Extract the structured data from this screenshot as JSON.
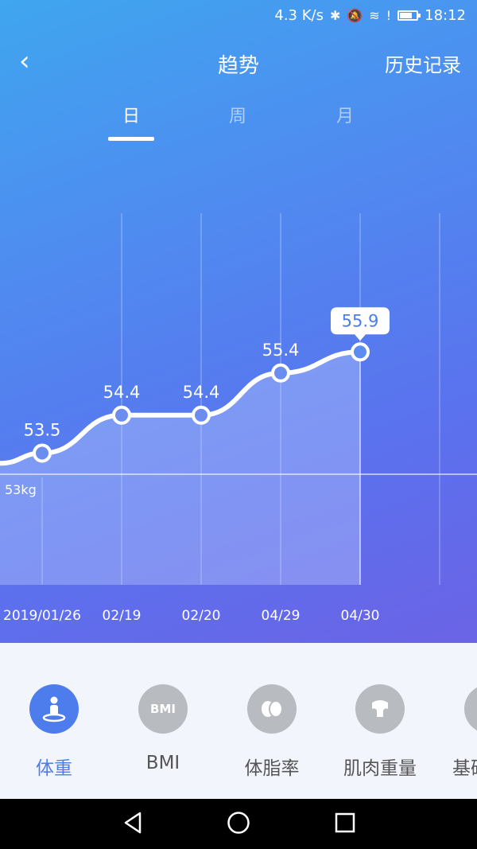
{
  "status": {
    "speed": "4.3 K/s",
    "time": "18:12",
    "battery": 0.75
  },
  "header": {
    "title": "趋势",
    "history_label": "历史记录",
    "back_symbol": "‹"
  },
  "tabs": [
    {
      "label": "日",
      "active": true
    },
    {
      "label": "周",
      "active": false
    },
    {
      "label": "月",
      "active": false
    }
  ],
  "chart_data": {
    "type": "line",
    "x": [
      "2019/01/26",
      "02/19",
      "02/20",
      "04/29",
      "04/30"
    ],
    "values": [
      53.5,
      54.4,
      54.4,
      55.4,
      55.9
    ],
    "selected_index": 4,
    "reference_line": {
      "value": 53,
      "label": "53kg"
    },
    "colors": {
      "line": "#ffffff",
      "area": "#c8d6ff"
    }
  },
  "metrics": [
    {
      "label": "体重",
      "icon": "person-scale-icon",
      "active": true
    },
    {
      "label": "BMI",
      "icon": "bmi-icon",
      "icon_text": "BMI",
      "active": false
    },
    {
      "label": "体脂率",
      "icon": "fat-drops-icon",
      "active": false
    },
    {
      "label": "肌肉重量",
      "icon": "muscle-icon",
      "active": false
    },
    {
      "label": "基础代谢",
      "icon": "metabolism-icon",
      "active": false
    }
  ],
  "colors": {
    "accent": "#4d7cec",
    "inactive_icon": "#b8bbc0"
  }
}
